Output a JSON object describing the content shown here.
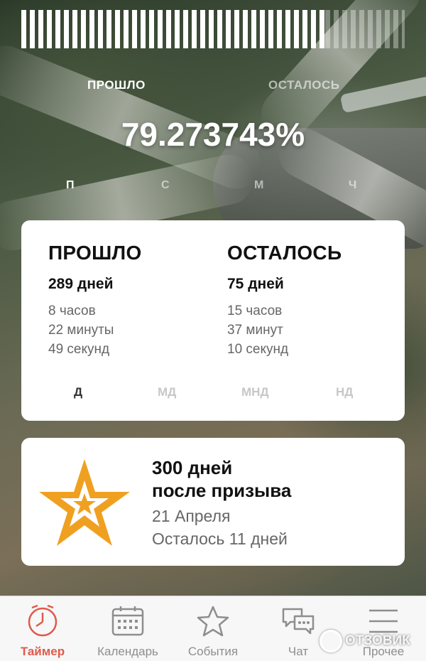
{
  "progress": {
    "percent_value": 79.273743
  },
  "hero": {
    "passed_label": "ПРОШЛО",
    "remaining_label": "ОСТАЛОСЬ",
    "percent_text": "79.273743%",
    "units": [
      "П",
      "С",
      "М",
      "Ч"
    ],
    "active_unit": "П"
  },
  "stats": {
    "passed": {
      "title": "ПРОШЛО",
      "days": "289 дней",
      "hours": "8 часов",
      "minutes": "22 минуты",
      "seconds": "49 секунд"
    },
    "remaining": {
      "title": "ОСТАЛОСЬ",
      "days": "75 дней",
      "hours": "15 часов",
      "minutes": "37 минут",
      "seconds": "10 секунд"
    },
    "tabs": [
      "Д",
      "МД",
      "МНД",
      "НД"
    ],
    "active_tab": "Д"
  },
  "event": {
    "line1": "300 дней",
    "line2": "после призыва",
    "date": "21 Апреля",
    "remaining": "Осталось 11 дней",
    "star_color": "#f0a020"
  },
  "nav": {
    "items": [
      {
        "label": "Таймер",
        "icon": "timer-icon"
      },
      {
        "label": "Календарь",
        "icon": "calendar-icon"
      },
      {
        "label": "События",
        "icon": "star-icon"
      },
      {
        "label": "Чат",
        "icon": "chat-icon"
      },
      {
        "label": "Прочее",
        "icon": "menu-icon"
      }
    ],
    "active_color": "#e05a4b",
    "inactive_color": "#8e8e8e"
  },
  "watermark": {
    "text": "ОТЗОВИК"
  }
}
